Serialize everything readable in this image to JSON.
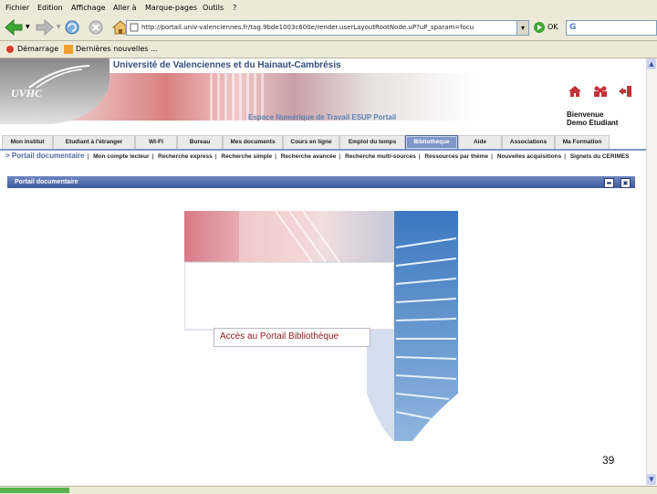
{
  "menubar": {
    "items": [
      "Fichier",
      "Edition",
      "Affichage",
      "Aller à",
      "Marque-pages",
      "Outils",
      "?"
    ]
  },
  "toolbar": {
    "address": "http://portail.univ-valenciennes.fr/tag.9bde1003c600e/render.userLayoutRootNode.uP?uP_sparam=focu",
    "go_label": "OK",
    "search_placeholder": "G"
  },
  "linksbar": {
    "items": [
      "Démarrage",
      "Dernières nouvelles ..."
    ]
  },
  "header": {
    "logo": "UVHC",
    "university": "Université de Valenciennes et du Hainaut-Cambrésis",
    "ent_title": "Espace Numérique de Travail ESUP Portail",
    "welcome_line1": "Bienvenue",
    "welcome_line2": "Demo Etudiant",
    "icons": [
      "home-icon",
      "group-icon",
      "logout-icon"
    ]
  },
  "tabs": [
    {
      "label": "Mon institut"
    },
    {
      "label": "Etudiant à l'étranger"
    },
    {
      "label": "WI-FI"
    },
    {
      "label": "Bureau"
    },
    {
      "label": "Mes documents"
    },
    {
      "label": "Cours en ligne"
    },
    {
      "label": "Emploi du temps"
    },
    {
      "label": "Bibliothèque",
      "active": true
    },
    {
      "label": "Aide"
    },
    {
      "label": "Associations"
    },
    {
      "label": "Ma Formation"
    }
  ],
  "submenu": {
    "current": "> Portail documentaire",
    "items": [
      "Mon compte lecteur",
      "Recherche express",
      "Recherche simple",
      "Recherche avancée",
      "Recherche multi-sources",
      "Ressources par thème",
      "Nouvelles acquisitions",
      "Signets du CERIMES"
    ]
  },
  "channel": {
    "title": "Portail documentaire"
  },
  "portal": {
    "link_label": "Accès au Portail Bibliothèque"
  },
  "slide_number": "39",
  "colors": {
    "tab_active": "#7f97c8",
    "channel_bar": "#3d5a9e",
    "title_blue": "#324f80",
    "link_red": "#8c1a1a"
  }
}
